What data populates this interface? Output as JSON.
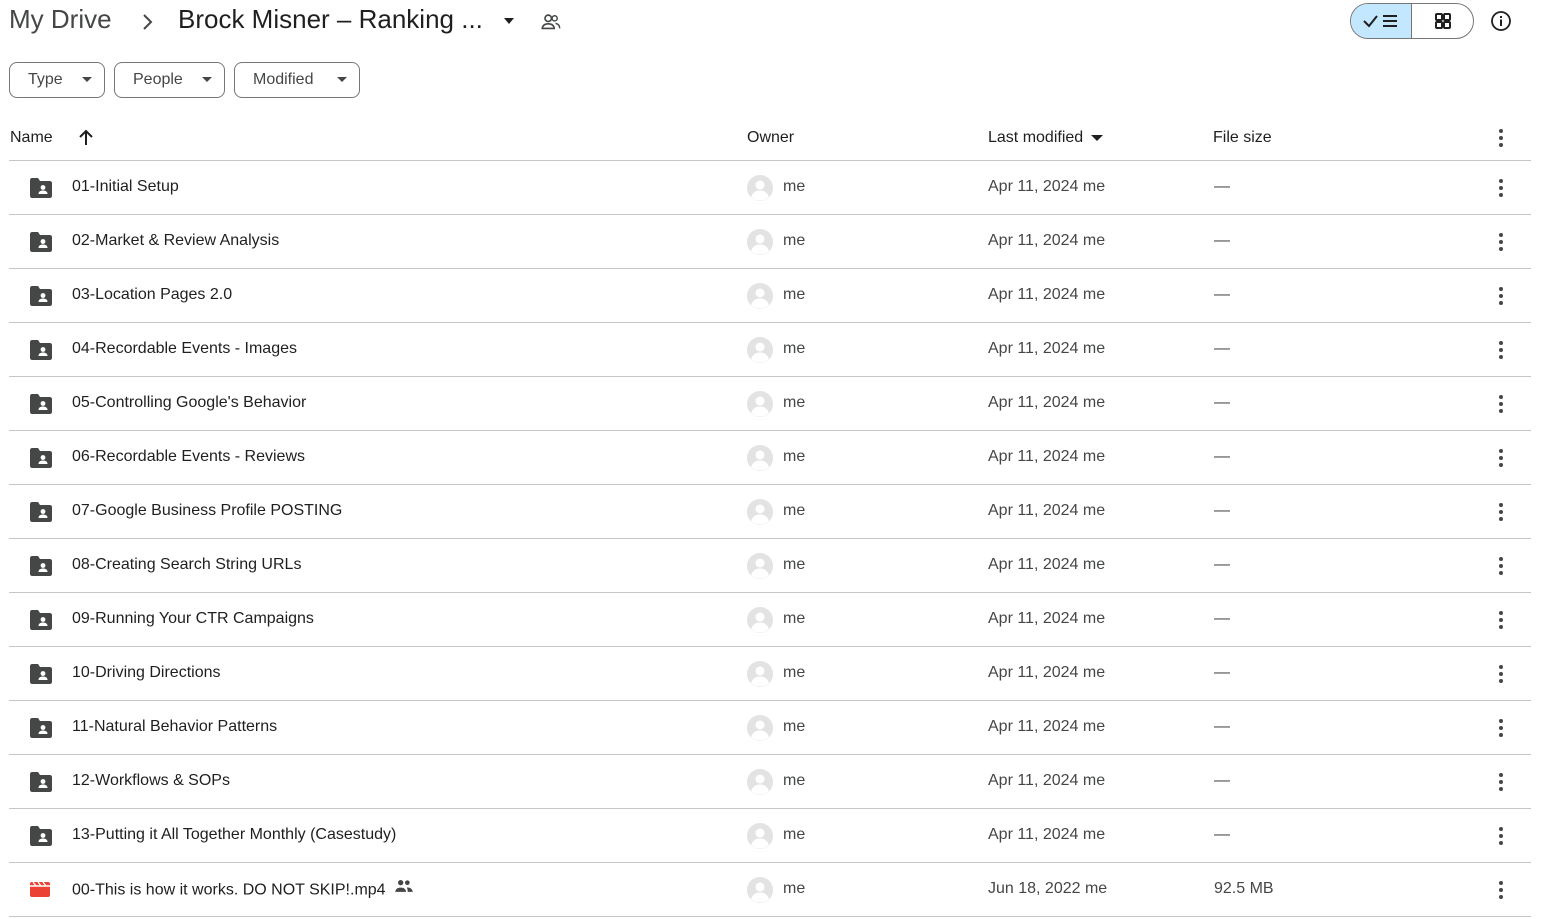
{
  "breadcrumb": {
    "root": "My Drive",
    "current": "Brock Misner – Ranking ..."
  },
  "filters": {
    "type": "Type",
    "people": "People",
    "modified": "Modified"
  },
  "columns": {
    "name": "Name",
    "owner": "Owner",
    "last_modified": "Last modified",
    "file_size": "File size"
  },
  "colors": {
    "accent_toggle": "#c2e7ff",
    "folder_icon": "#444746",
    "video_icon": "#ea4335",
    "divider": "#c4c7c5"
  },
  "files": [
    {
      "name": "01-Initial Setup",
      "type": "shared-folder",
      "owner": "me",
      "modified": "Apr 11, 2024 me",
      "size": "—"
    },
    {
      "name": "02-Market & Review Analysis",
      "type": "shared-folder",
      "owner": "me",
      "modified": "Apr 11, 2024 me",
      "size": "—"
    },
    {
      "name": "03-Location Pages 2.0",
      "type": "shared-folder",
      "owner": "me",
      "modified": "Apr 11, 2024 me",
      "size": "—"
    },
    {
      "name": "04-Recordable Events - Images",
      "type": "shared-folder",
      "owner": "me",
      "modified": "Apr 11, 2024 me",
      "size": "—"
    },
    {
      "name": "05-Controlling Google's Behavior",
      "type": "shared-folder",
      "owner": "me",
      "modified": "Apr 11, 2024 me",
      "size": "—"
    },
    {
      "name": "06-Recordable Events - Reviews",
      "type": "shared-folder",
      "owner": "me",
      "modified": "Apr 11, 2024 me",
      "size": "—"
    },
    {
      "name": "07-Google Business Profile POSTING",
      "type": "shared-folder",
      "owner": "me",
      "modified": "Apr 11, 2024 me",
      "size": "—"
    },
    {
      "name": "08-Creating Search String URLs",
      "type": "shared-folder",
      "owner": "me",
      "modified": "Apr 11, 2024 me",
      "size": "—"
    },
    {
      "name": "09-Running Your CTR Campaigns",
      "type": "shared-folder",
      "owner": "me",
      "modified": "Apr 11, 2024 me",
      "size": "—"
    },
    {
      "name": "10-Driving Directions",
      "type": "shared-folder",
      "owner": "me",
      "modified": "Apr 11, 2024 me",
      "size": "—"
    },
    {
      "name": "11-Natural Behavior Patterns",
      "type": "shared-folder",
      "owner": "me",
      "modified": "Apr 11, 2024 me",
      "size": "—"
    },
    {
      "name": "12-Workflows & SOPs",
      "type": "shared-folder",
      "owner": "me",
      "modified": "Apr 11, 2024 me",
      "size": "—"
    },
    {
      "name": "13-Putting it All Together Monthly (Casestudy)",
      "type": "shared-folder",
      "owner": "me",
      "modified": "Apr 11, 2024 me",
      "size": "—"
    },
    {
      "name": "00-This is how it works. DO NOT SKIP!.mp4",
      "type": "video",
      "shared": true,
      "owner": "me",
      "modified": "Jun 18, 2022 me",
      "size": "92.5 MB"
    }
  ]
}
